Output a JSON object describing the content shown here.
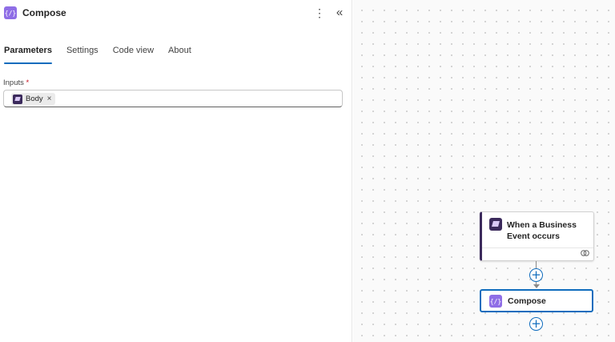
{
  "panel": {
    "title": "Compose",
    "icon": "code-brackets-icon",
    "more_glyph": "⋮",
    "collapse_glyph": "«",
    "tabs": [
      {
        "label": "Parameters",
        "active": true
      },
      {
        "label": "Settings",
        "active": false
      },
      {
        "label": "Code view",
        "active": false
      },
      {
        "label": "About",
        "active": false
      }
    ],
    "inputs": {
      "label": "Inputs",
      "required_marker": "*",
      "token": {
        "label": "Body",
        "icon": "business-event-icon",
        "remove_glyph": "×"
      }
    }
  },
  "canvas": {
    "trigger_card": {
      "title": "When a Business Event occurs",
      "icon": "business-event-icon",
      "footer_icon": "link-icon"
    },
    "action_card": {
      "title": "Compose",
      "icon": "code-brackets-icon"
    },
    "add_glyph": "+"
  },
  "colors": {
    "accent": "#0f6cbd",
    "compose_icon": "#8f6ee6",
    "trigger_icon": "#3b2a5c"
  }
}
